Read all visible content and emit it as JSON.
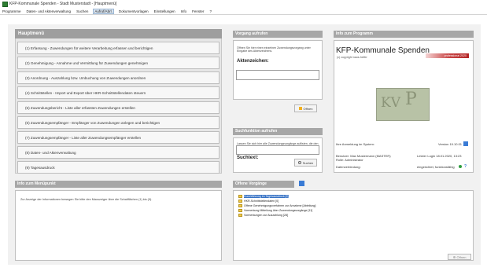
{
  "window": {
    "title": "KFP-Kommunale Spenden - Stadt Musterstadt - [Hauptmenü]"
  },
  "menubar": {
    "items": [
      {
        "label": "Programme",
        "active": false
      },
      {
        "label": "Daten- und Aktenverwaltung",
        "active": false
      },
      {
        "label": "Suchen",
        "active": false
      },
      {
        "label": "Aufruf/Abrl.",
        "active": true
      },
      {
        "label": "Dokumentvorlagen",
        "active": false
      },
      {
        "label": "Einstellungen",
        "active": false
      },
      {
        "label": "Info",
        "active": false
      },
      {
        "label": "Fenster",
        "active": false
      },
      {
        "label": "?",
        "active": false
      }
    ]
  },
  "main_menu": {
    "header": "Hauptmenü",
    "items": [
      "(1) Erfassung - Zuwendungen für weitere Verarbeitung erfassen und berichtigen",
      "(2) Genehmigung - Annahme und Vermittlung für Zuwendungen genehmigen",
      "(3) Anordnung - Auszahlung bzw. Umbuchung von Zuwendungen anordnen",
      "(4) Schnittstellen - Import und Export über HKR-Schnittstellendaten steuern",
      "(5) Zuwendungsbericht - Liste aller erfassten Zuwendungen erstellen",
      "(6) Zuwendungsempfänger - Empfänger von Zuwendungen anlegen und berichtigen",
      "(7) Zuwendungsempfänger - Liste aller Zuwendungsempfänger erstellen",
      "(8) Daten- und Aktenverwaltung",
      "(9) Tagesausdruck"
    ]
  },
  "vorgang": {
    "header": "Vorgang aufrufen",
    "hint": "Öffnen Sie hier einen einzelnen Zuwendungsvorgang unter Eingabe des Aktenzeichens.",
    "label": "Aktenzeichen:",
    "value": "",
    "button": "Öffnen"
  },
  "suche": {
    "header": "Suchfunktion aufrufen",
    "hint": "Lassen Sie sich hier alle Zuwendungsvorgänge auflisten, die den Suchtext enthalten.",
    "label": "Suchtext:",
    "value": "",
    "button": "Suchen"
  },
  "info_programm": {
    "header": "Info zum Programm",
    "title": "KFP-Kommunale Spenden",
    "copyright": "(c) copyright naos-helfer",
    "edition": "professional 2020",
    "logo_text_left": "KV",
    "logo_text_right": "P",
    "anmeldung_label": "Ihre Anmeldung im System:",
    "version": "Version 19.10.01",
    "benutzer": "Benutzer: Max Mustermann (MASTER)",
    "rolle": "Rolle: Administrator",
    "letzter_login": "Letzter Login 18.01.2020, 13:23",
    "datenverbindung_label": "Datenverbindung:",
    "datenverbindung_status": "eingerichtet, funktionsfähig"
  },
  "info_menupunkt": {
    "header": "Info zum Menüpunkt",
    "text": "Zur Anzeige der Informationen bewegen Sie bitte den Mauszeiger über die Schaltflächen (1) bis (9)."
  },
  "offene_vorgaenge": {
    "header": "Offene Vorgänge",
    "items": [
      {
        "label": "Durchführung im Tagesausdruck [0]",
        "selected": true
      },
      {
        "label": "HKR-Schnittstellendaten [0]",
        "selected": false
      },
      {
        "label": "Offene Genehmigungsverfahren zur Annahme [Abteilung]",
        "selected": false
      },
      {
        "label": "Vormerkung Mitteilung über Zuwendungsvorgänge [11]",
        "selected": false
      },
      {
        "label": "Vormerkungen zur Auszahlung [28]",
        "selected": false
      }
    ],
    "button": "Öffnen"
  },
  "colors": {
    "header_bg": "#a7a7a7",
    "accent_blue": "#3873c5",
    "badge_red": "#c84545",
    "workspace_bg": "#f1f1f1"
  },
  "icons": [
    "app-icon",
    "folder-icon",
    "open-icon",
    "search-icon",
    "refresh-icon",
    "help-icon",
    "status-ok-icon"
  ]
}
